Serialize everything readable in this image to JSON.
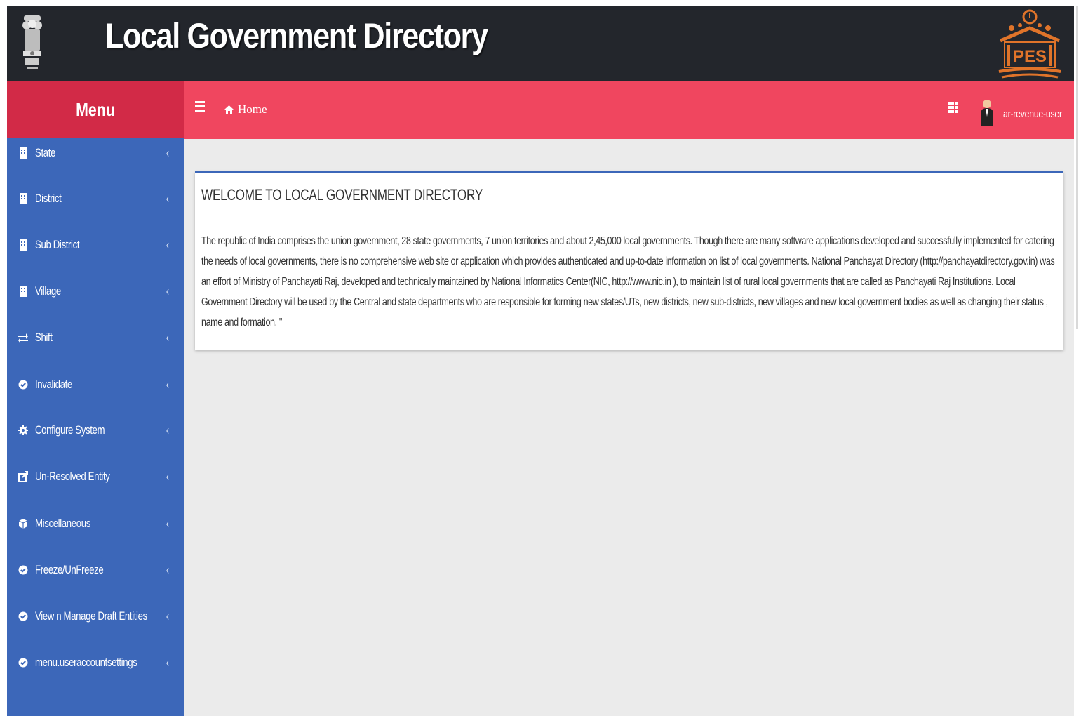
{
  "header": {
    "title": "Local Government Directory",
    "left_logo": "india-emblem",
    "right_logo_text": "PES"
  },
  "menu": {
    "title": "Menu"
  },
  "topbar": {
    "menu_toggle_icon": "hamburger-icon",
    "home_label": "Home",
    "apps_icon": "apps-grid-icon",
    "user_name": "ar-revenue-user"
  },
  "sidebar": {
    "items": [
      {
        "label": "State",
        "icon": "building-icon"
      },
      {
        "label": "District",
        "icon": "building-icon"
      },
      {
        "label": "Sub District",
        "icon": "building-icon"
      },
      {
        "label": "Village",
        "icon": "building-icon"
      },
      {
        "label": "Shift",
        "icon": "exchange-icon"
      },
      {
        "label": "Invalidate",
        "icon": "check-circle-icon"
      },
      {
        "label": "Configure System",
        "icon": "gear-icon"
      },
      {
        "label": "Un-Resolved Entity",
        "icon": "external-link-icon"
      },
      {
        "label": "Miscellaneous",
        "icon": "cube-icon"
      },
      {
        "label": "Freeze/UnFreeze",
        "icon": "check-circle-icon"
      },
      {
        "label": "View n Manage Draft Entities",
        "icon": "check-circle-icon"
      },
      {
        "label": "menu.useraccountsettings",
        "icon": "check-circle-icon"
      }
    ],
    "chevron": "‹"
  },
  "welcome": {
    "title": "WELCOME TO LOCAL GOVERNMENT DIRECTORY",
    "body": "The republic of India comprises the union government, 28 state governments, 7 union territories and about 2,45,000 local governments. Though there are many software applications developed and successfully implemented for catering the needs of local governments, there is no comprehensive web site or application which provides authenticated and up-to-date information on list of local governments. National Panchayat Directory (http://panchayatdirectory.gov.in) was an effort of Ministry of Panchayati Raj, developed and technically maintained by National Informatics Center(NIC, http://www.nic.in ), to maintain list of rural local governments that are called as Panchayati Raj Institutions. Local Government Directory will be used by the Central and state departments who are responsible for forming new states/UTs, new districts, new sub-districts, new villages and new local government bodies as well as changing their status , name and formation. \""
  },
  "colors": {
    "header_bg": "#23262c",
    "menu_header_bg": "#d22a47",
    "topbar_bg": "#f0465f",
    "sidebar_bg": "#3c67b9",
    "content_bg": "#ebebeb",
    "box_border": "#3c67b9"
  }
}
